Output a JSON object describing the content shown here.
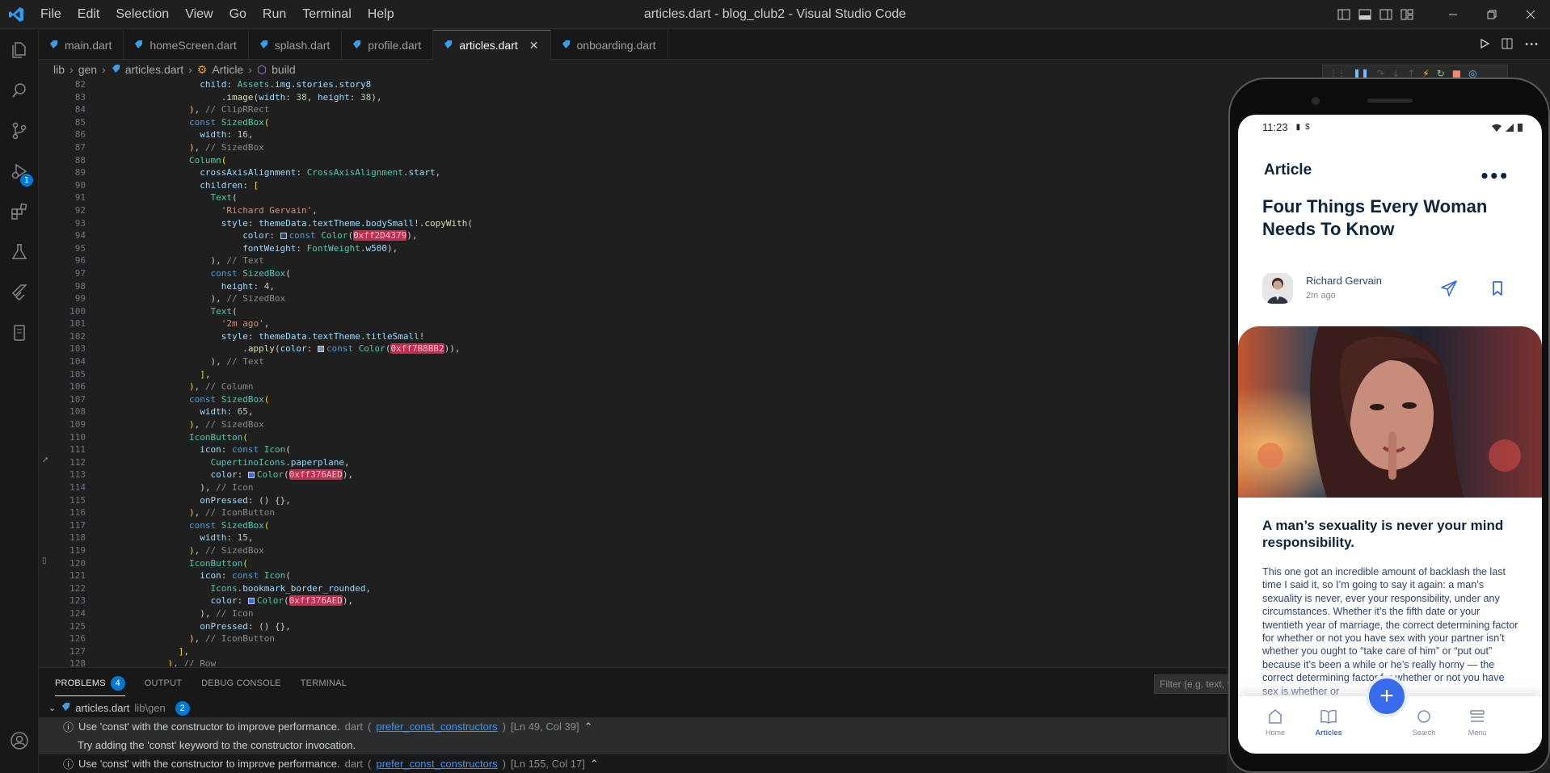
{
  "window": {
    "title": "articles.dart - blog_club2 - Visual Studio Code",
    "menu": [
      "File",
      "Edit",
      "Selection",
      "View",
      "Go",
      "Run",
      "Terminal",
      "Help"
    ]
  },
  "activity": {
    "debug_badge": "1"
  },
  "tabs": [
    {
      "label": "main.dart"
    },
    {
      "label": "homeScreen.dart"
    },
    {
      "label": "splash.dart"
    },
    {
      "label": "profile.dart"
    },
    {
      "label": "articles.dart",
      "active": true
    },
    {
      "label": "onboarding.dart"
    }
  ],
  "breadcrumb": [
    "lib",
    "gen",
    "articles.dart",
    "Article",
    "build"
  ],
  "editor": {
    "line_numbers": [
      "82",
      "83",
      "84",
      "85",
      "86",
      "87",
      "88",
      "89",
      "90",
      "91",
      "92",
      "93",
      "94",
      "95",
      "96",
      "97",
      "98",
      "99",
      "100",
      "101",
      "102",
      "103",
      "104",
      "105",
      "106",
      "107",
      "108",
      "109",
      "110",
      "111",
      "112",
      "113",
      "114",
      "115",
      "116",
      "117",
      "118",
      "119",
      "120",
      "121",
      "122",
      "123",
      "124",
      "125",
      "126",
      "127",
      "128"
    ]
  },
  "panel": {
    "tabs": [
      "PROBLEMS",
      "OUTPUT",
      "DEBUG CONSOLE",
      "TERMINAL"
    ],
    "problems_count": "4",
    "filter_placeholder": "Filter (e.g. text, **/*.ts, !**/node_modules/**)",
    "file": {
      "name": "articles.dart",
      "path": "lib\\gen",
      "count": "2"
    },
    "problems": [
      {
        "message": "Use 'const' with the constructor to improve performance.",
        "source": "dart",
        "code": "prefer_const_constructors",
        "location": "[Ln 49, Col 39]"
      },
      {
        "message": "Try adding the 'const' keyword to the constructor invocation."
      },
      {
        "message": "Use 'const' with the constructor to improve performance.",
        "source": "dart",
        "code": "prefer_const_constructors",
        "location": "[Ln 155, Col 17]"
      }
    ]
  },
  "phone": {
    "status_time": "11:23",
    "appbar_title": "Article",
    "more_label": "•••",
    "article_title": "Four Things Every Woman Needs To Know",
    "author_name": "Richard Gervain",
    "author_time": "2m ago",
    "heading": "A man’s sexuality is never your mind responsibility.",
    "body": "This one got an incredible amount of backlash the last time I said it, so I’m going to say it again: a man’s sexuality is never, ever your responsibility, under any circumstances. Whether it’s the fifth date or your twentieth year of marriage, the correct determining factor for whether or not you have sex with your partner isn’t whether you ought to “take care of him” or “put out” because it’s been a while or he’s really horny — the correct determining factor for whether or not you have sex is whether or",
    "nav": [
      {
        "label": "Home",
        "icon": "home-icon"
      },
      {
        "label": "Articles",
        "icon": "book-icon",
        "active": true
      },
      {
        "label": "Search",
        "icon": "search-icon"
      },
      {
        "label": "Menu",
        "icon": "menu-icon"
      }
    ],
    "fab_label": "+",
    "accent": "#376AED"
  }
}
